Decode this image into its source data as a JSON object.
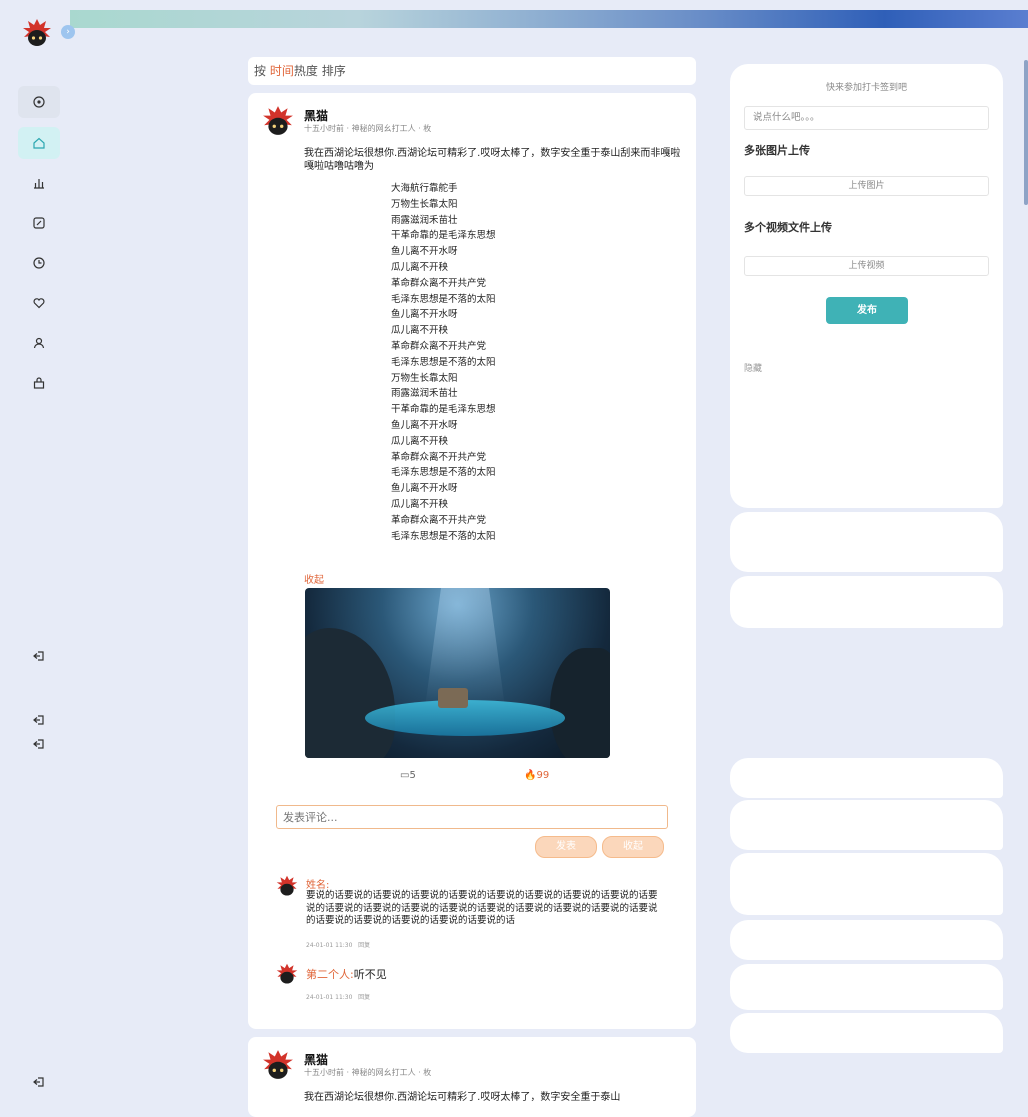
{
  "sidebar": {
    "items": [
      "target-icon",
      "home-icon",
      "chart-icon",
      "edit-icon",
      "clock-icon",
      "heart-icon",
      "user-icon",
      "bag-icon"
    ],
    "bottom_items": [
      "logout-icon",
      "logout-icon",
      "logout-icon",
      "logout-icon"
    ]
  },
  "sort": {
    "prefix": "按",
    "time": "时间",
    "hot": "热度",
    "suffix": "排序"
  },
  "post": {
    "author": "黑猫",
    "meta": "十五小时前 · 神秘的网幺打工人 · 枚",
    "text": "我在西湖论坛很想你.西湖论坛可精彩了.哎呀太棒了，数字安全重于泰山刮来而非嘎啦嘎啦咕噜咕噜为",
    "poem": [
      "大海航行靠舵手",
      "万物生长靠太阳",
      "雨露滋润禾苗壮",
      "干革命靠的是毛泽东思想",
      "鱼儿离不开水呀",
      "瓜儿离不开秧",
      "革命群众离不开共产党",
      "毛泽东思想是不落的太阳",
      "鱼儿离不开水呀",
      "瓜儿离不开秧",
      "革命群众离不开共产党",
      "毛泽东思想是不落的太阳",
      "万物生长靠太阳",
      "雨露滋润禾苗壮",
      "干革命靠的是毛泽东思想",
      "鱼儿离不开水呀",
      "瓜儿离不开秧",
      "革命群众离不开共产党",
      "毛泽东思想是不落的太阳",
      "鱼儿离不开水呀",
      "瓜儿离不开秧",
      "革命群众离不开共产党",
      "毛泽东思想是不落的太阳"
    ],
    "collapse": "收起",
    "comment_count": "5",
    "hot_count": "99",
    "comment_placeholder": "发表评论...",
    "publish_btn": "发表",
    "fold_btn": "收起",
    "comments": [
      {
        "name": "姓名:",
        "text": "要说的话要说的话要说的话要说的话要说的话要说的话要说的话要说的话要说的话要说的话要说的话要说的话要说的话要说的话要说的话要说的话要说的话要说的话要说的话要说的话要说的话要说的话要说的话要说的话",
        "time": "24-01-01 11:30",
        "reply": "回复"
      },
      {
        "name": "第二个人:",
        "text": "听不见",
        "time": "24-01-01 11:30",
        "reply": "回复"
      }
    ]
  },
  "post2": {
    "author": "黑猫",
    "meta": "十五小时前 · 神秘的网幺打工人 · 枚",
    "text": "我在西湖论坛很想你.西湖论坛可精彩了.哎呀太棒了，数字安全重于泰山"
  },
  "right": {
    "title": "快来参加打卡签到吧",
    "input_placeholder": "说点什么吧。。。",
    "images_heading": "多张图片上传",
    "upload_image": "上传图片",
    "videos_heading": "多个视频文件上传",
    "upload_video": "上传视频",
    "submit": "发布",
    "hide": "隐藏"
  },
  "colors": {
    "accent_orange": "#e0663a",
    "accent_teal": "#3fb2b6",
    "background": "#e7ebf7"
  }
}
